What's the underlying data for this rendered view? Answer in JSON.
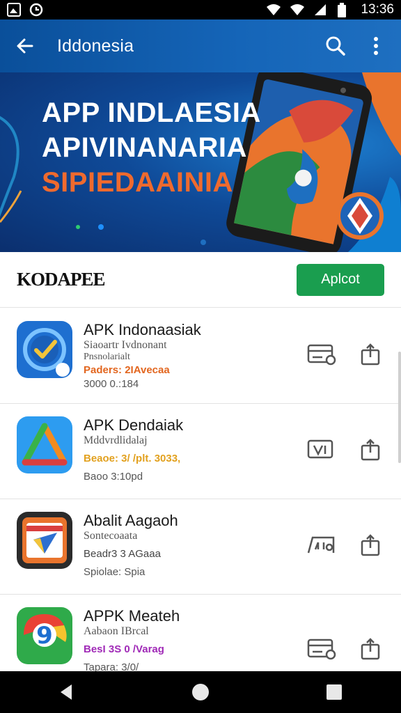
{
  "status_bar": {
    "time": "13:36"
  },
  "app_bar": {
    "title": "Iddonesia"
  },
  "banner": {
    "line1": "APP INDLAESIA",
    "line2": "APIVINANARIA",
    "line3": "SIPIEDAAINIA"
  },
  "section": {
    "title": "KODAPEE",
    "button_label": "Aplcot"
  },
  "apps": [
    {
      "name": "APK Indonaasiak",
      "subtitle": "Siaoartr Ivdnonant",
      "subtitle2": "Pnsnolarialt",
      "meta": "Paders: 2IAvecaa",
      "meta_color": "#e2661f",
      "size": "3000 0.:184",
      "icon": "shield-check-icon"
    },
    {
      "name": "APK Dendaiak",
      "subtitle": "Mddvrdlidalaj",
      "subtitle2": "",
      "meta": "Beaoe: 3/ /plt. 3033,",
      "meta_color": "#e2a11f",
      "size": "Baoo 3:10pd",
      "icon": "triangle-app-icon"
    },
    {
      "name": "Abalit Aagaoh",
      "subtitle": "Sontecoaata",
      "subtitle2": "",
      "meta": "Beadr3 3 AGaaa",
      "meta_color": "#444444",
      "size": "Spiolae: Spia",
      "icon": "map-app-icon"
    },
    {
      "name": "APPK Meateh",
      "subtitle": "Aabaon IBrcal",
      "subtitle2": "",
      "meta": "BesI 3S 0 /Varag",
      "meta_color": "#a02ab7",
      "size": "Tapara: 3/0/",
      "icon": "nine-app-icon"
    }
  ],
  "row_action_labels": [
    "",
    "",
    "",
    ""
  ]
}
